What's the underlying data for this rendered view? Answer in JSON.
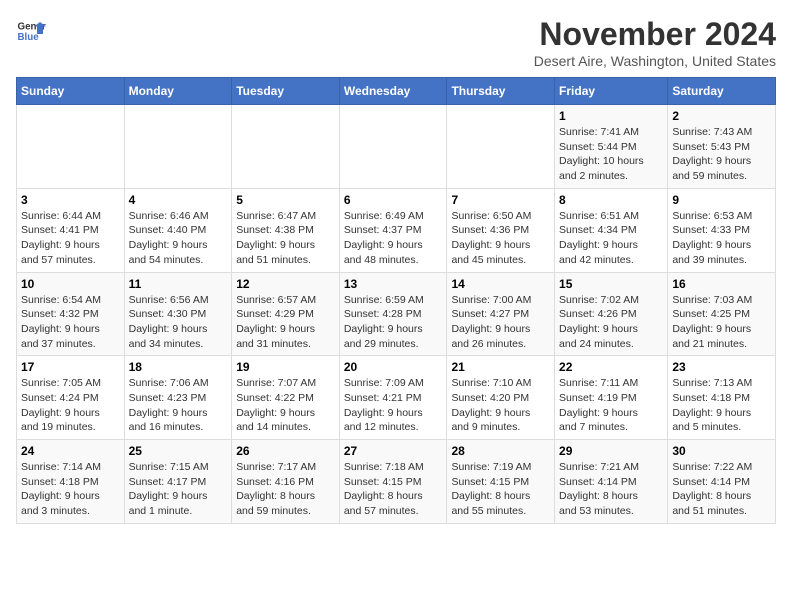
{
  "logo": {
    "line1": "General",
    "line2": "Blue"
  },
  "title": "November 2024",
  "subtitle": "Desert Aire, Washington, United States",
  "days_of_week": [
    "Sunday",
    "Monday",
    "Tuesday",
    "Wednesday",
    "Thursday",
    "Friday",
    "Saturday"
  ],
  "weeks": [
    [
      {
        "day": "",
        "detail": ""
      },
      {
        "day": "",
        "detail": ""
      },
      {
        "day": "",
        "detail": ""
      },
      {
        "day": "",
        "detail": ""
      },
      {
        "day": "",
        "detail": ""
      },
      {
        "day": "1",
        "detail": "Sunrise: 7:41 AM\nSunset: 5:44 PM\nDaylight: 10 hours\nand 2 minutes."
      },
      {
        "day": "2",
        "detail": "Sunrise: 7:43 AM\nSunset: 5:43 PM\nDaylight: 9 hours\nand 59 minutes."
      }
    ],
    [
      {
        "day": "3",
        "detail": "Sunrise: 6:44 AM\nSunset: 4:41 PM\nDaylight: 9 hours\nand 57 minutes."
      },
      {
        "day": "4",
        "detail": "Sunrise: 6:46 AM\nSunset: 4:40 PM\nDaylight: 9 hours\nand 54 minutes."
      },
      {
        "day": "5",
        "detail": "Sunrise: 6:47 AM\nSunset: 4:38 PM\nDaylight: 9 hours\nand 51 minutes."
      },
      {
        "day": "6",
        "detail": "Sunrise: 6:49 AM\nSunset: 4:37 PM\nDaylight: 9 hours\nand 48 minutes."
      },
      {
        "day": "7",
        "detail": "Sunrise: 6:50 AM\nSunset: 4:36 PM\nDaylight: 9 hours\nand 45 minutes."
      },
      {
        "day": "8",
        "detail": "Sunrise: 6:51 AM\nSunset: 4:34 PM\nDaylight: 9 hours\nand 42 minutes."
      },
      {
        "day": "9",
        "detail": "Sunrise: 6:53 AM\nSunset: 4:33 PM\nDaylight: 9 hours\nand 39 minutes."
      }
    ],
    [
      {
        "day": "10",
        "detail": "Sunrise: 6:54 AM\nSunset: 4:32 PM\nDaylight: 9 hours\nand 37 minutes."
      },
      {
        "day": "11",
        "detail": "Sunrise: 6:56 AM\nSunset: 4:30 PM\nDaylight: 9 hours\nand 34 minutes."
      },
      {
        "day": "12",
        "detail": "Sunrise: 6:57 AM\nSunset: 4:29 PM\nDaylight: 9 hours\nand 31 minutes."
      },
      {
        "day": "13",
        "detail": "Sunrise: 6:59 AM\nSunset: 4:28 PM\nDaylight: 9 hours\nand 29 minutes."
      },
      {
        "day": "14",
        "detail": "Sunrise: 7:00 AM\nSunset: 4:27 PM\nDaylight: 9 hours\nand 26 minutes."
      },
      {
        "day": "15",
        "detail": "Sunrise: 7:02 AM\nSunset: 4:26 PM\nDaylight: 9 hours\nand 24 minutes."
      },
      {
        "day": "16",
        "detail": "Sunrise: 7:03 AM\nSunset: 4:25 PM\nDaylight: 9 hours\nand 21 minutes."
      }
    ],
    [
      {
        "day": "17",
        "detail": "Sunrise: 7:05 AM\nSunset: 4:24 PM\nDaylight: 9 hours\nand 19 minutes."
      },
      {
        "day": "18",
        "detail": "Sunrise: 7:06 AM\nSunset: 4:23 PM\nDaylight: 9 hours\nand 16 minutes."
      },
      {
        "day": "19",
        "detail": "Sunrise: 7:07 AM\nSunset: 4:22 PM\nDaylight: 9 hours\nand 14 minutes."
      },
      {
        "day": "20",
        "detail": "Sunrise: 7:09 AM\nSunset: 4:21 PM\nDaylight: 9 hours\nand 12 minutes."
      },
      {
        "day": "21",
        "detail": "Sunrise: 7:10 AM\nSunset: 4:20 PM\nDaylight: 9 hours\nand 9 minutes."
      },
      {
        "day": "22",
        "detail": "Sunrise: 7:11 AM\nSunset: 4:19 PM\nDaylight: 9 hours\nand 7 minutes."
      },
      {
        "day": "23",
        "detail": "Sunrise: 7:13 AM\nSunset: 4:18 PM\nDaylight: 9 hours\nand 5 minutes."
      }
    ],
    [
      {
        "day": "24",
        "detail": "Sunrise: 7:14 AM\nSunset: 4:18 PM\nDaylight: 9 hours\nand 3 minutes."
      },
      {
        "day": "25",
        "detail": "Sunrise: 7:15 AM\nSunset: 4:17 PM\nDaylight: 9 hours\nand 1 minute."
      },
      {
        "day": "26",
        "detail": "Sunrise: 7:17 AM\nSunset: 4:16 PM\nDaylight: 8 hours\nand 59 minutes."
      },
      {
        "day": "27",
        "detail": "Sunrise: 7:18 AM\nSunset: 4:15 PM\nDaylight: 8 hours\nand 57 minutes."
      },
      {
        "day": "28",
        "detail": "Sunrise: 7:19 AM\nSunset: 4:15 PM\nDaylight: 8 hours\nand 55 minutes."
      },
      {
        "day": "29",
        "detail": "Sunrise: 7:21 AM\nSunset: 4:14 PM\nDaylight: 8 hours\nand 53 minutes."
      },
      {
        "day": "30",
        "detail": "Sunrise: 7:22 AM\nSunset: 4:14 PM\nDaylight: 8 hours\nand 51 minutes."
      }
    ]
  ]
}
